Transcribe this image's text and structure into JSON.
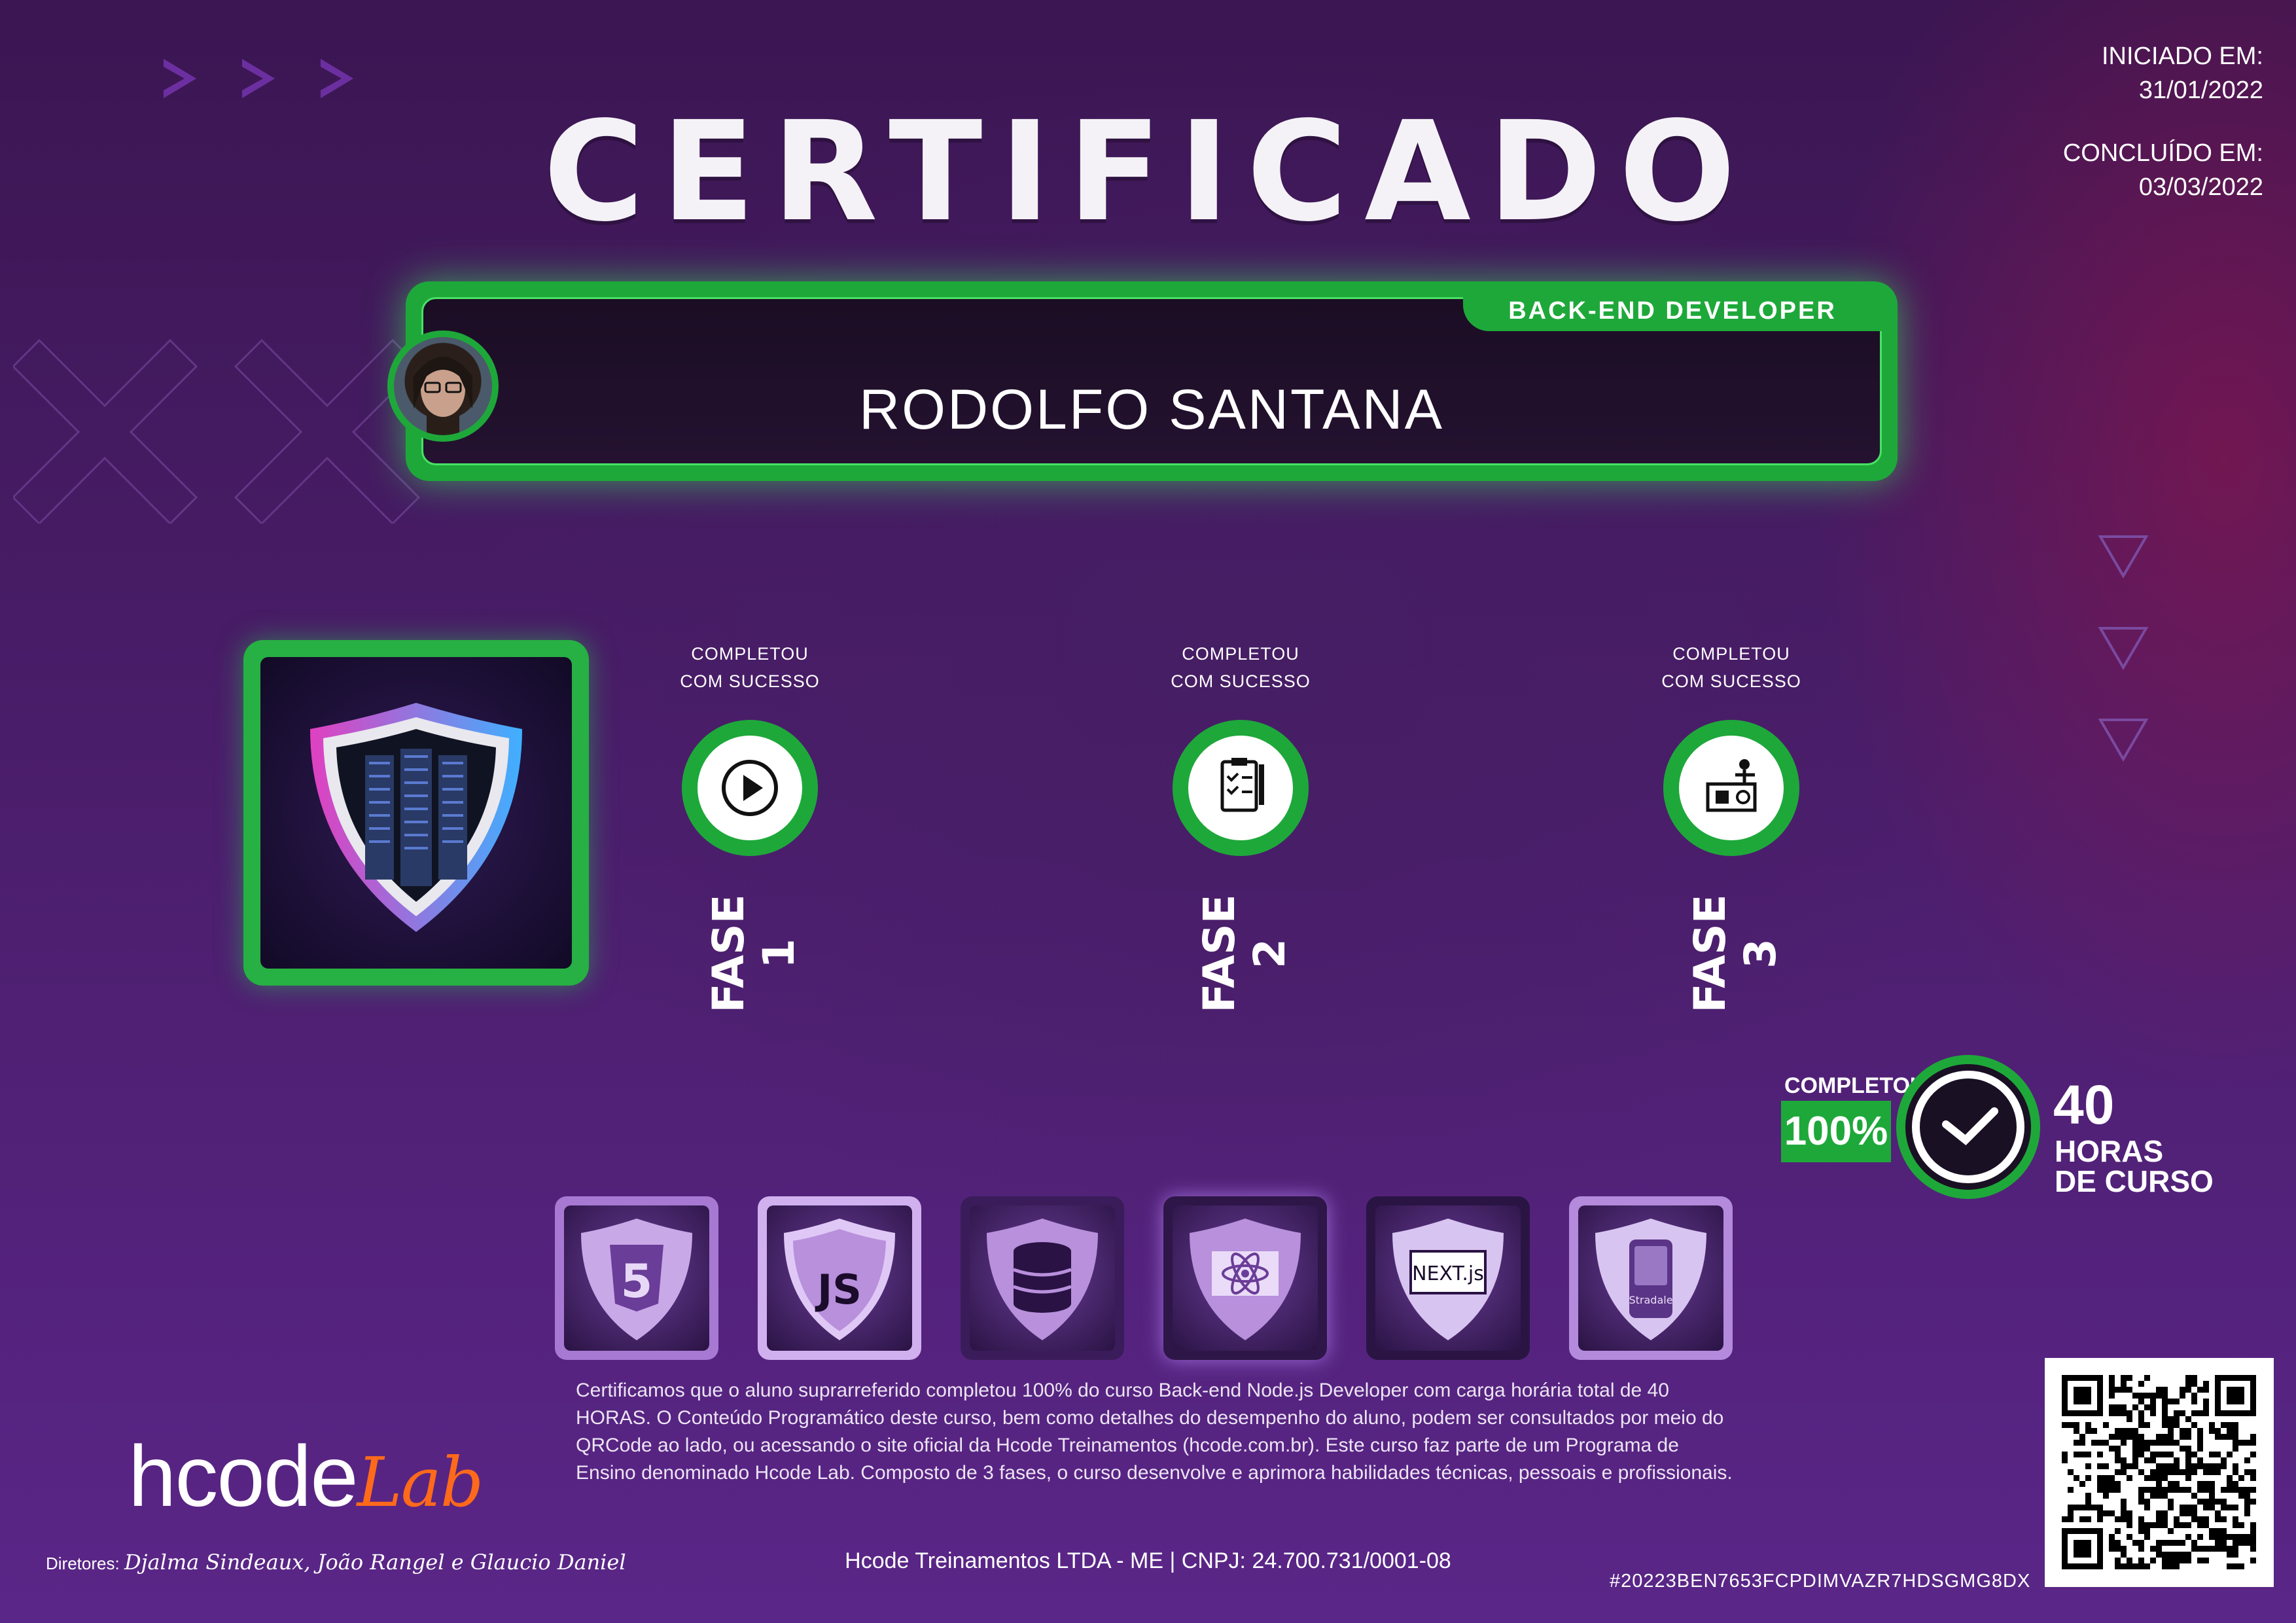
{
  "title": "CERTIFICADO",
  "dates": {
    "started_label": "INICIADO EM:",
    "started_value": "31/01/2022",
    "finished_label": "CONCLUÍDO EM:",
    "finished_value": "03/03/2022"
  },
  "plate": {
    "role": "BACK-END DEVELOPER",
    "name": "RODOLFO SANTANA"
  },
  "phases": [
    {
      "caption_1": "COMPLETOU",
      "caption_2": "COM SUCESSO",
      "label": "FASE 1",
      "icon": "play-icon"
    },
    {
      "caption_1": "COMPLETOU",
      "caption_2": "COM SUCESSO",
      "label": "FASE 2",
      "icon": "checklist-icon"
    },
    {
      "caption_1": "COMPLETOU",
      "caption_2": "COM SUCESSO",
      "label": "FASE 3",
      "icon": "presentation-icon"
    }
  ],
  "completion": {
    "label": "COMPLETOU",
    "percent": "100%",
    "hours_number": "40",
    "hours_line1": "HORAS",
    "hours_line2": "DE CURSO"
  },
  "tech_badges": [
    {
      "icon": "html5-icon",
      "label": "5"
    },
    {
      "icon": "javascript-icon",
      "label": "JS"
    },
    {
      "icon": "database-icon",
      "label": ""
    },
    {
      "icon": "react-icon",
      "label": ""
    },
    {
      "icon": "nextjs-icon",
      "label": "NEXT.js"
    },
    {
      "icon": "car-app-icon",
      "label": "Stradale"
    }
  ],
  "certification_text": "Certificamos que o aluno suprarreferido completou 100% do curso Back-end Node.js Developer com carga horária total de 40 HORAS. O Conteúdo Programático deste curso, bem como detalhes do desempenho do aluno, podem ser consultados por meio do QRCode ao lado, ou acessando o site oficial da Hcode Treinamentos (hcode.com.br). Este curso faz parte de um Programa de Ensino denominado Hcode Lab. Composto de 3 fases, o curso desenvolve e aprimora habilidades técnicas, pessoais e profissionais.",
  "company": "Hcode Treinamentos LTDA - ME | CNPJ: 24.700.731/0001-08",
  "hash": "#20223BEN7653FCPDIMVAZR7HDSGMG8DX",
  "logo": {
    "main": "hcode",
    "accent": "Lab"
  },
  "directors": {
    "label": "Diretores:",
    "names": "Djalma Sindeaux, João Rangel e Glaucio Daniel"
  },
  "colors": {
    "accent_green": "#1ea83a",
    "brand_orange": "#ff6a1a",
    "background_purple": "#4a1d6a"
  }
}
